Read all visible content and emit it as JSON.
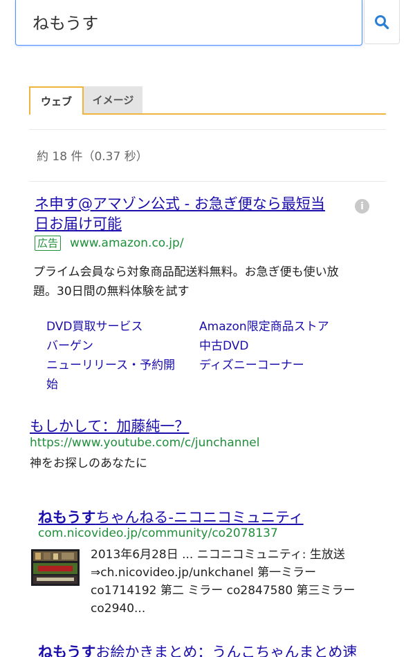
{
  "search": {
    "query": "ねもうす",
    "button_icon": "search-icon",
    "accent": "#4d90fe"
  },
  "tabs": [
    {
      "label": "ウェブ",
      "active": true
    },
    {
      "label": "イメージ",
      "active": false
    }
  ],
  "result_count": "約 18 件（0.37 秒）",
  "ad": {
    "title_line1": "ネ申す@アマゾン公式 - お急ぎ便なら最短当",
    "title_line2": "日お届け可能",
    "badge": "広告",
    "url": "www.amazon.co.jp/",
    "desc_line1": "プライム会員なら対象商品配送料無料。お急ぎ便も使い放",
    "desc_line2": "題。30日間の無料体験を試す",
    "sitelinks": [
      {
        "label": "DVD買取サービス"
      },
      {
        "label": "Amazon限定商品ストア"
      },
      {
        "label": "バーゲン"
      },
      {
        "label": "中古DVD"
      },
      {
        "label": "ニューリリース・予約開"
      },
      {
        "label": "ディズニーコーナー"
      },
      {
        "label": "始"
      }
    ]
  },
  "result2": {
    "title": "もしかして：加藤純一？",
    "url": "https://www.youtube.com/c/junchannel",
    "desc": "神をお探しのあなたに"
  },
  "result3": {
    "title_bold": "ねもうす",
    "title_rest": "ちゃんねる-ニコニコミュニティ",
    "url": "com.nicovideo.jp/community/co2078137",
    "desc_line1": "2013年6月28日 ... ニコニコミュニティ: 生放送",
    "desc_line2": "⇒ch.nicovideo.jp/unkchanel 第一ミラー",
    "desc_line3": "co1714192 第二 ミラー co2847580 第三ミラー",
    "desc_line4": "co2940..."
  },
  "result4": {
    "title_bold": "ねもうす",
    "title_rest": "お絵かきまとめ：うんこちゃんまとめ速"
  },
  "colors": {
    "link": "#1a0dab",
    "url_green": "#1f8f3a",
    "tab_accent": "#f0b43c"
  }
}
